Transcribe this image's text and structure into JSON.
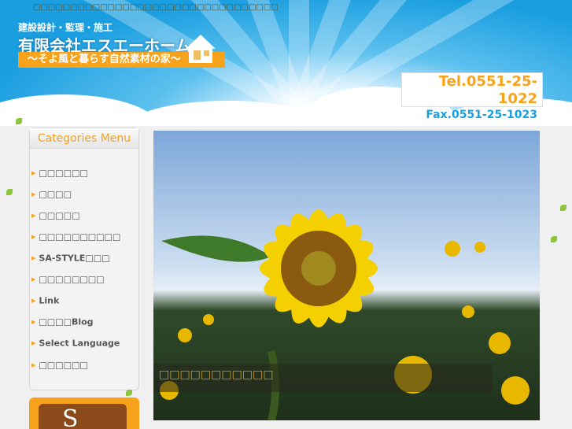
{
  "header": {
    "top_text": "□□□□□□□□□□□□□□□□□□□□□□□□□□□□□□□□□",
    "subtitle": "建設設計・監理・施工",
    "company": "有限会社エスエーホーム",
    "tagline": "〜そよ風と暮らす自然素材の家〜",
    "tel": "Tel.0551-25-1022",
    "fax": "Fax.0551-25-1023"
  },
  "menu": {
    "title": "Categories Menu",
    "items": [
      {
        "label": "□□□□□□"
      },
      {
        "label": "□□□□"
      },
      {
        "label": "□□□□□"
      },
      {
        "label": "□□□□□□□□□□"
      },
      {
        "label": "SA-STYLE□□□"
      },
      {
        "label": "□□□□□□□□"
      },
      {
        "label": "Link"
      },
      {
        "label": "□□□□Blog"
      },
      {
        "label": "Select Language"
      },
      {
        "label": "□□□□□□"
      }
    ]
  },
  "banner": {
    "letter": "S"
  },
  "slideshow": {
    "caption": "□□□□□□□□□□□"
  },
  "colors": {
    "accent": "#f7a21b",
    "sky": "#1a9ee0"
  }
}
